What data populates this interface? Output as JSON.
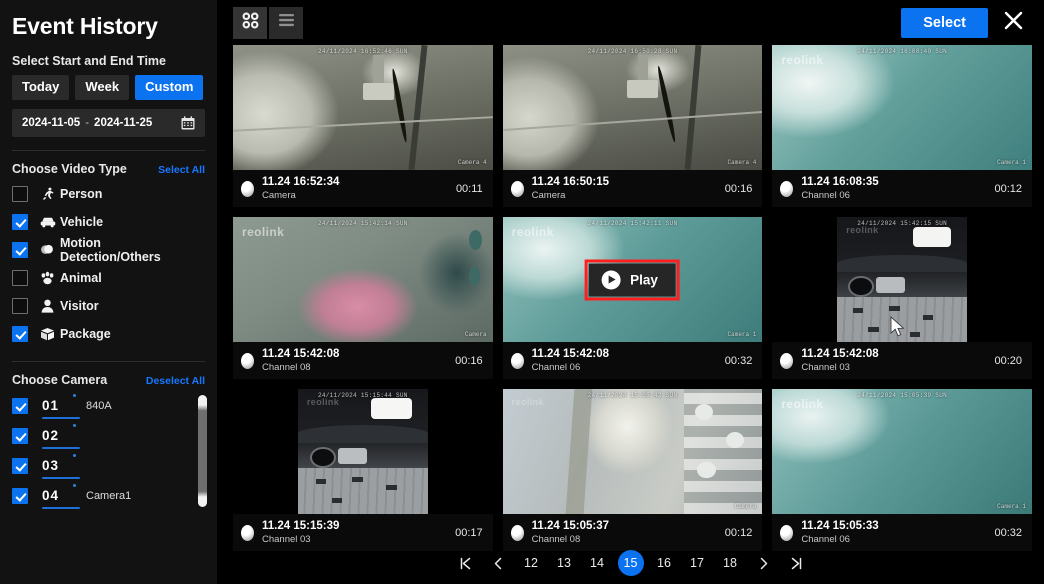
{
  "sidebar": {
    "title": "Event History",
    "time_section_label": "Select Start and End Time",
    "range_buttons": [
      {
        "label": "Today",
        "active": false
      },
      {
        "label": "Week",
        "active": false
      },
      {
        "label": "Custom",
        "active": true
      }
    ],
    "date_range": {
      "start": "2024-11-05",
      "separator": "-",
      "end": "2024-11-25"
    },
    "video_type": {
      "label": "Choose Video Type",
      "link": "Select All",
      "items": [
        {
          "label": "Person",
          "icon": "person-running-icon",
          "checked": false
        },
        {
          "label": "Vehicle",
          "icon": "car-icon",
          "checked": true
        },
        {
          "label": "Motion Detection/Others",
          "icon": "motion-icon",
          "checked": true
        },
        {
          "label": "Animal",
          "icon": "paw-icon",
          "checked": false
        },
        {
          "label": "Visitor",
          "icon": "visitor-icon",
          "checked": false
        },
        {
          "label": "Package",
          "icon": "package-icon",
          "checked": true
        }
      ]
    },
    "camera": {
      "label": "Choose Camera",
      "link": "Deselect All",
      "items": [
        {
          "number": "01",
          "name": "840A",
          "checked": true
        },
        {
          "number": "02",
          "name": "",
          "checked": true
        },
        {
          "number": "03",
          "name": "",
          "checked": true
        },
        {
          "number": "04",
          "name": "Camera1",
          "checked": true
        }
      ]
    }
  },
  "toolbar": {
    "grid_view": "grid-view",
    "list_view": "list-view",
    "select_label": "Select",
    "close_label": "✕"
  },
  "cards": [
    {
      "time": "11.24 16:52:34",
      "channel": "Camera",
      "duration": "00:11",
      "osd_time": "24/11/2024 16:52:46 SUN",
      "osd_cam": "Camera 4",
      "style": "garage-light",
      "watermark": "",
      "portrait": false
    },
    {
      "time": "11.24 16:50:15",
      "channel": "Camera",
      "duration": "00:16",
      "osd_time": "24/11/2024 16:50:28 SUN",
      "osd_cam": "Camera 4",
      "style": "garage-light",
      "watermark": "",
      "portrait": false
    },
    {
      "time": "11.24 16:08:35",
      "channel": "Channel 06",
      "duration": "00:12",
      "osd_time": "24/11/2024 16:08:40 SUN",
      "osd_cam": "Camera 1",
      "style": "teal",
      "watermark": "reolink",
      "portrait": false
    },
    {
      "time": "11.24 15:42:08",
      "channel": "Channel 08",
      "duration": "00:16",
      "osd_time": "24/11/2024 15:42:14 SUN",
      "osd_cam": "Camera",
      "style": "pink",
      "watermark": "reolink",
      "portrait": false
    },
    {
      "time": "11.24 15:42:08",
      "channel": "Channel 06",
      "duration": "00:32",
      "osd_time": "24/11/2024 15:42:11 SUN",
      "osd_cam": "Camera 1",
      "style": "teal",
      "watermark": "reolink",
      "portrait": false,
      "hover_play": true
    },
    {
      "time": "11.24 15:42:08",
      "channel": "Channel 03",
      "duration": "00:20",
      "osd_time": "24/11/2024 15:42:15 SUN",
      "osd_cam": "",
      "style": "dark-garage",
      "watermark": "reolink",
      "portrait": true
    },
    {
      "time": "11.24 15:15:39",
      "channel": "Channel 03",
      "duration": "00:17",
      "osd_time": "24/11/2024 15:15:44 SUN",
      "osd_cam": "",
      "style": "dark-garage",
      "watermark": "reolink",
      "portrait": true
    },
    {
      "time": "11.24 15:05:37",
      "channel": "Channel 08",
      "duration": "00:12",
      "osd_time": "24/11/2024 15:05:42 SUN",
      "osd_cam": "Camera",
      "style": "grey",
      "watermark": "reolink",
      "portrait": false
    },
    {
      "time": "11.24 15:05:33",
      "channel": "Channel 06",
      "duration": "00:32",
      "osd_time": "24/11/2024 15:05:39 SUN",
      "osd_cam": "Camera 1",
      "style": "teal",
      "watermark": "reolink",
      "portrait": false
    }
  ],
  "play_overlay": {
    "label": "Play",
    "highlight_color": "#ff1f1f"
  },
  "pagination": {
    "first": "first-page",
    "prev": "prev-page",
    "pages": [
      "12",
      "13",
      "14",
      "15",
      "16",
      "17",
      "18"
    ],
    "active": "15",
    "next": "next-page",
    "last": "last-page"
  },
  "colors": {
    "accent": "#0b72f0",
    "sidebar_bg": "#121212",
    "main_bg": "#000000"
  }
}
